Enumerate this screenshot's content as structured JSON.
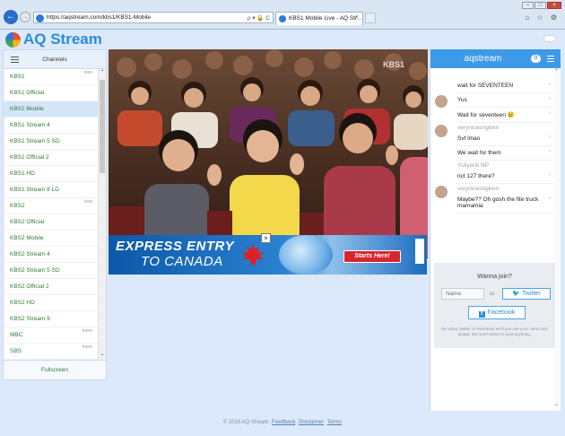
{
  "browser": {
    "url": "https://aqstream.com/kbs1/KBS1-Mobile",
    "address_controls": "ρ ▾ 🔒 C",
    "tab_title": "KBS1 Mobile Live - AQ Str...",
    "tab_close": "×",
    "win_min": "–",
    "win_max": "□",
    "win_close": "×",
    "tools": "⌂ ☆ ⚙"
  },
  "header": {
    "logo_text": "AQ Stream"
  },
  "sidebar": {
    "title": "Channels",
    "fullscreen": "Fullscreen",
    "items": [
      {
        "label": "KBS1",
        "more": "less",
        "type": "group"
      },
      {
        "label": "KBS1 Official",
        "type": "channel"
      },
      {
        "label": "KBS1 Mobile",
        "type": "channel",
        "active": true
      },
      {
        "label": "KBS1 Stream 4",
        "type": "channel"
      },
      {
        "label": "KBS1 Stream 5 SD",
        "type": "channel"
      },
      {
        "label": "KBS1 Official 2",
        "type": "channel"
      },
      {
        "label": "KBS1 HD",
        "type": "channel"
      },
      {
        "label": "KBS1 Stream 8 LD",
        "type": "channel"
      },
      {
        "label": "KBS2",
        "more": "less",
        "type": "group"
      },
      {
        "label": "KBS2 Official",
        "type": "channel"
      },
      {
        "label": "KBS2 Mobile",
        "type": "channel"
      },
      {
        "label": "KBS2 Stream 4",
        "type": "channel"
      },
      {
        "label": "KBS2 Stream 5 SD",
        "type": "channel"
      },
      {
        "label": "KBS2 Official 2",
        "type": "channel"
      },
      {
        "label": "KBS2 HD",
        "type": "channel"
      },
      {
        "label": "KBS2 Stream 9",
        "type": "channel"
      },
      {
        "label": "MBC",
        "more": "more",
        "type": "group"
      },
      {
        "label": "SBS",
        "more": "more",
        "type": "group"
      }
    ]
  },
  "video": {
    "watermark": "KBS1"
  },
  "ad": {
    "line1": "EXPRESS ENTRY",
    "line2": "TO CANADA",
    "cta": "Starts Here!",
    "close": "×"
  },
  "chat": {
    "title": "aqstream",
    "count": "0",
    "messages": [
      {
        "user": "",
        "text": "wait for SEVENTEEN",
        "avatar": false
      },
      {
        "user": "",
        "text": "Yus",
        "avatar": true
      },
      {
        "user": "",
        "text": "Wait for seventeen 😢",
        "avatar": false
      },
      {
        "user": "verynicesngkwn",
        "text": "Svt lmao",
        "avatar": true
      },
      {
        "user": "",
        "text": "We wait for them",
        "avatar": false
      },
      {
        "user": "Yuliyanti NP",
        "text": "nct 127 there?",
        "avatar": false
      },
      {
        "user": "verynicesngkwn",
        "text": "Maybe?? Oh gosh the fite truck mamamia",
        "avatar": true
      }
    ],
    "join": {
      "title": "Wanna join?",
      "name_placeholder": "Name",
      "or": "or",
      "twitter": "Twitter",
      "facebook": "Facebook",
      "disclaimer": "By using Twitter or Facebook we'll just use your name and avatar. We won't tweet or post anything."
    }
  },
  "footer": {
    "copyright": "© 2016 AQ Stream",
    "links": [
      "Feedback",
      "Disclaimer",
      "Terms"
    ]
  },
  "colors": {
    "brand_blue": "#3d9ae8",
    "channel_green": "#2e7d32",
    "page_bg": "#dbe9fb"
  }
}
